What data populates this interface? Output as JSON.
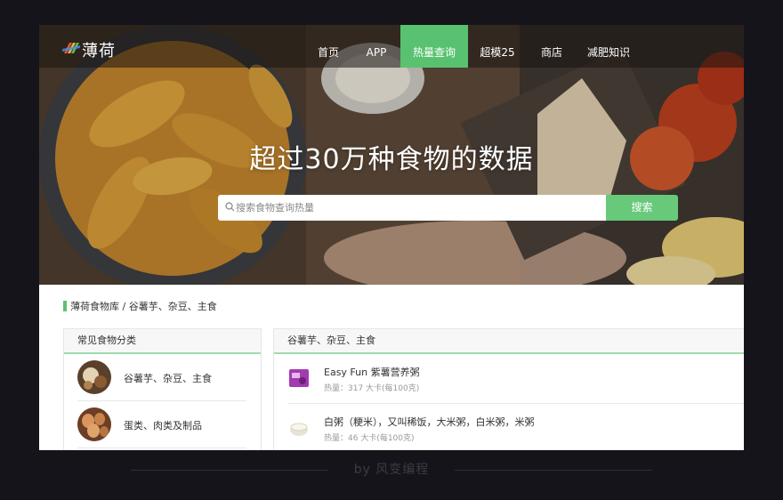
{
  "brand": {
    "logo_text": "薄荷"
  },
  "nav": {
    "items": [
      {
        "label": "首页",
        "active": false
      },
      {
        "label": "APP",
        "active": false
      },
      {
        "label": "热量查询",
        "active": true
      },
      {
        "label": "超模25",
        "active": false
      },
      {
        "label": "商店",
        "active": false
      },
      {
        "label": "减肥知识",
        "active": false
      }
    ]
  },
  "hero": {
    "title": "超过30万种食物的数据"
  },
  "search": {
    "placeholder": "搜索食物查询热量",
    "button_label": "搜索"
  },
  "breadcrumb": "薄荷食物库 / 谷薯芋、杂豆、主食",
  "categories": {
    "title": "常见食物分类",
    "items": [
      {
        "label": "谷薯芋、杂豆、主食",
        "icon": "grain-thumb-icon"
      },
      {
        "label": "蛋类、肉类及制品",
        "icon": "egg-thumb-icon"
      }
    ]
  },
  "food_list": {
    "title": "谷薯芋、杂豆、主食",
    "items": [
      {
        "name": "Easy Fun 紫薯营养粥",
        "calories": "热量：317 大卡(每100克)",
        "icon": "purple-package-icon"
      },
      {
        "name": "白粥（粳米），又叫稀饭，大米粥，白米粥，米粥",
        "calories": "热量：46 大卡(每100克)",
        "icon": "rice-porridge-icon"
      }
    ]
  },
  "caption": "by 风变编程",
  "colors": {
    "accent": "#59c270",
    "search_button": "#68c97a",
    "background": "#15141b"
  }
}
